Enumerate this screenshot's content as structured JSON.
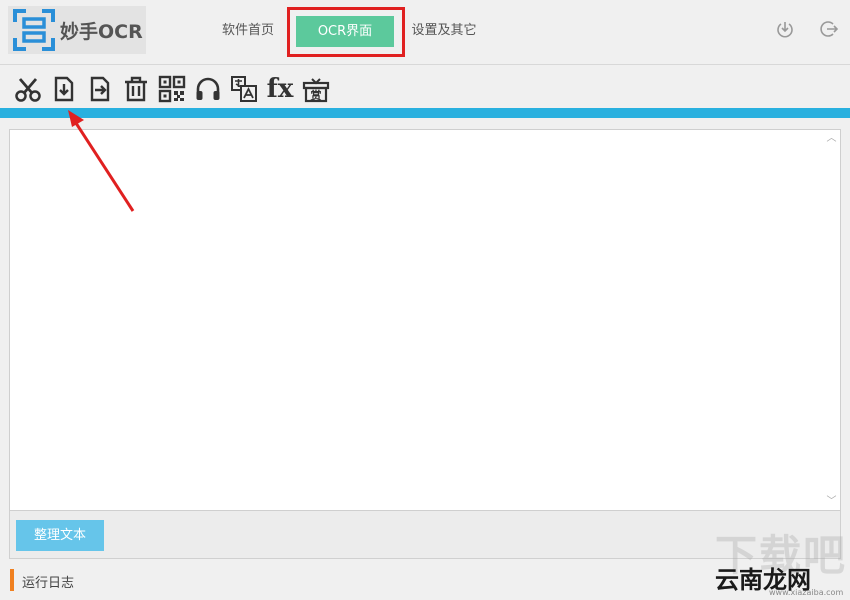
{
  "app": {
    "logo_text": "妙手OCR"
  },
  "nav": {
    "tabs": [
      {
        "label": "软件首页"
      },
      {
        "label": "OCR界面"
      },
      {
        "label": "设置及其它"
      }
    ],
    "active_tab": "OCR界面"
  },
  "toolbar": {
    "icons": [
      "scissors-icon",
      "import-icon",
      "export-icon",
      "trash-icon",
      "qr-code-icon",
      "headphones-icon",
      "translate-icon",
      "fx-formula-icon",
      "reward-gift-icon"
    ],
    "fx_label": "fx",
    "reward_label": "赏"
  },
  "editor": {
    "content": ""
  },
  "actions": {
    "tidy_text_label": "整理文本"
  },
  "log": {
    "label": "运行日志"
  },
  "watermark": {
    "big_text": "下载吧",
    "brand": "云南龙网",
    "domain": "www.xiazaiba.com"
  },
  "colors": {
    "active_tab": "#5cc99c",
    "accent_bar": "#29b0df",
    "tidy_button": "#66c5ea",
    "highlight_box": "#e02020",
    "log_marker": "#f08020",
    "brand_blue": "#2a8fd8"
  }
}
